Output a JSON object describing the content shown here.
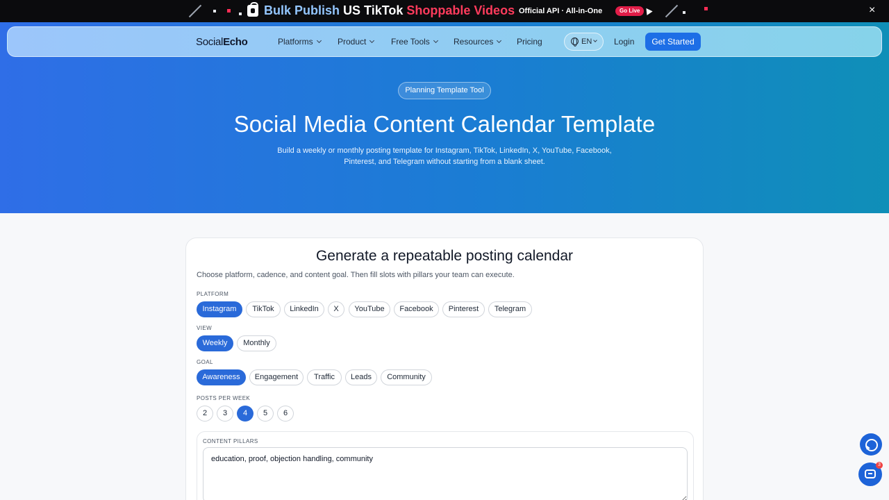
{
  "promo": {
    "headline_part1": "Bulk Publish ",
    "headline_part2": "US TikTok ",
    "headline_part3": "Shoppable Videos",
    "api_text": "Official API · All-in-One",
    "live_badge": "Go Live",
    "close_icon": "×"
  },
  "nav": {
    "logo_part1": "Social",
    "logo_part2": "Echo",
    "items": [
      "Platforms",
      "Product",
      "Free Tools",
      "Resources",
      "Pricing"
    ],
    "language": "EN",
    "login": "Login",
    "cta": "Get Started"
  },
  "hero": {
    "badge": "Planning Template Tool",
    "title": "Social Media Content Calendar Template",
    "subtitle": "Build a weekly or monthly posting template for Instagram, TikTok, LinkedIn, X, YouTube, Facebook, Pinterest, and Telegram without starting from a blank sheet."
  },
  "generator": {
    "title": "Generate a repeatable posting calendar",
    "subtitle": "Choose platform, cadence, and content goal. Then fill slots with pillars your team can execute.",
    "platform_label": "PLATFORM",
    "platforms": [
      "Instagram",
      "TikTok",
      "LinkedIn",
      "X",
      "YouTube",
      "Facebook",
      "Pinterest",
      "Telegram"
    ],
    "platform_selected": "Instagram",
    "view_label": "VIEW",
    "views": [
      "Weekly",
      "Monthly"
    ],
    "view_selected": "Weekly",
    "goal_label": "GOAL",
    "goals": [
      "Awareness",
      "Engagement",
      "Traffic",
      "Leads",
      "Community"
    ],
    "goal_selected": "Awareness",
    "posts_label": "POSTS PER WEEK",
    "posts_options": [
      "2",
      "3",
      "4",
      "5",
      "6"
    ],
    "posts_selected": "4",
    "pillars_label": "CONTENT PILLARS",
    "pillars_value": "education, proof, objection handling, community"
  },
  "widgets": {
    "support_count": "3"
  },
  "colors": {
    "accent": "#2a6ad9",
    "cta": "#1d6ee6",
    "promo_red": "#ff3b5c",
    "promo_blue": "#93c5fd"
  }
}
